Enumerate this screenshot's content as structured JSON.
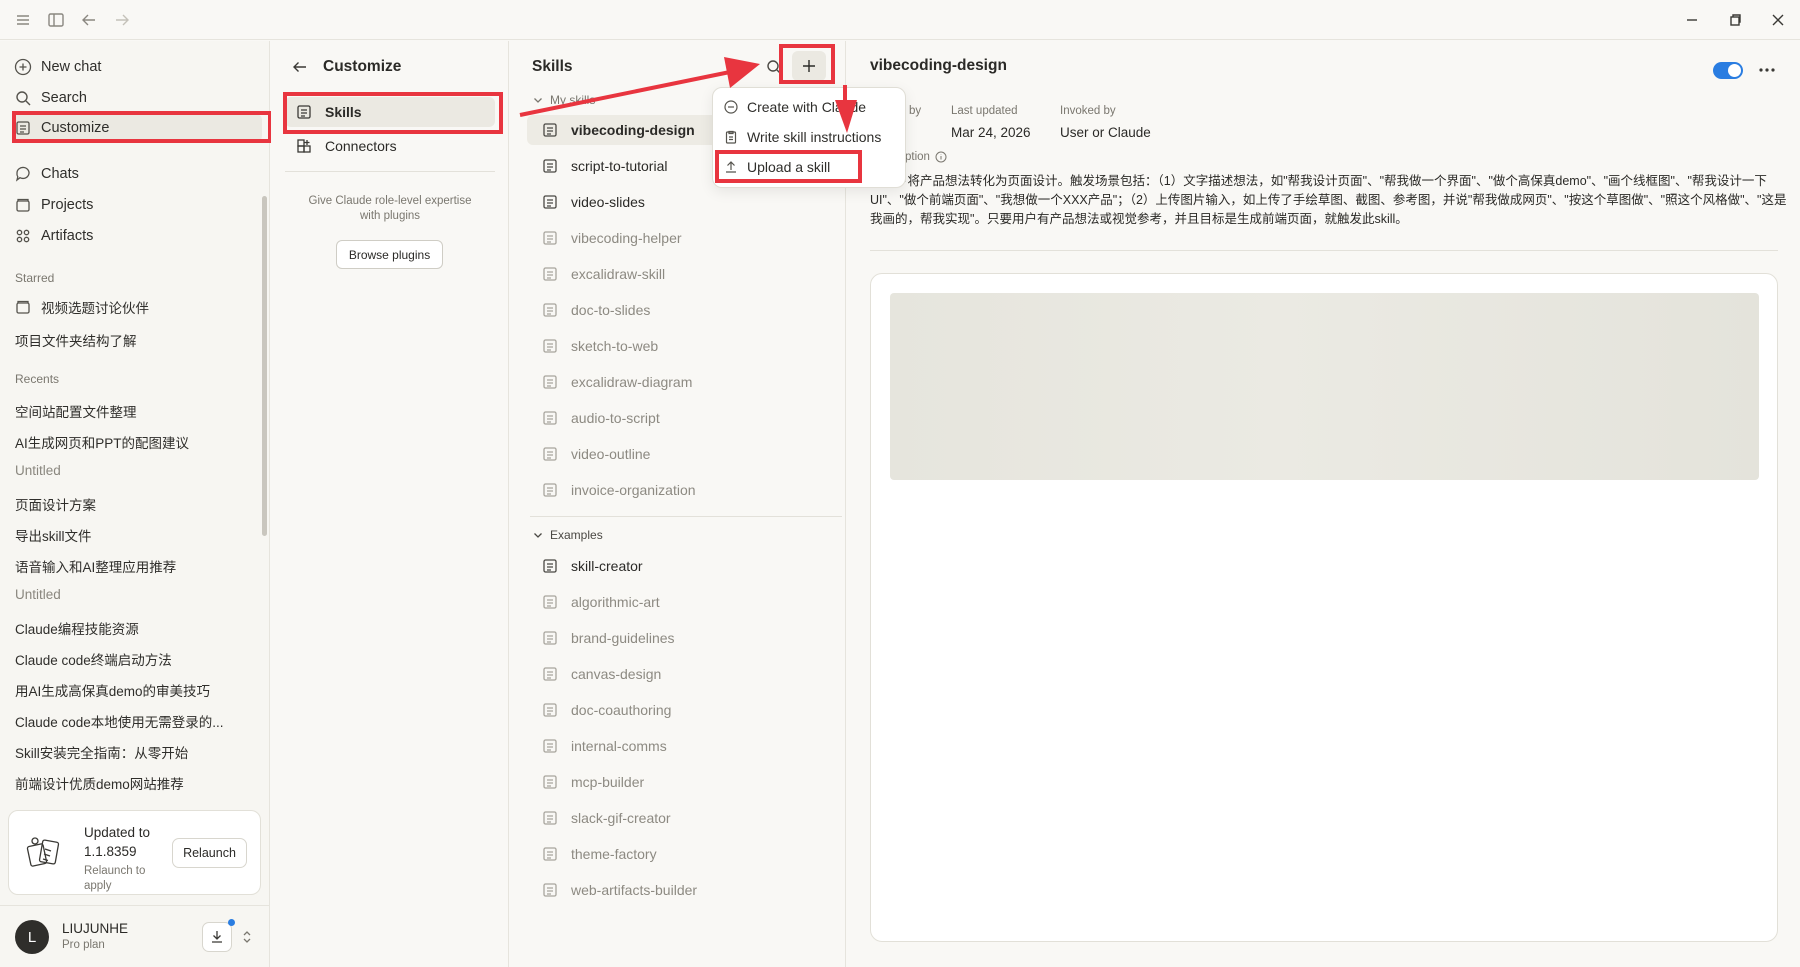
{
  "sidebar": {
    "new_chat": "New chat",
    "search": "Search",
    "customize": "Customize",
    "chats": "Chats",
    "projects": "Projects",
    "artifacts": "Artifacts",
    "starred_label": "Starred",
    "starred": [
      "视频选题讨论伙伴",
      "项目文件夹结构了解"
    ],
    "recents_label": "Recents",
    "recents": [
      "空间站配置文件整理",
      "AI生成网页和PPT的配图建议",
      "Untitled",
      "页面设计方案",
      "导出skill文件",
      "语音输入和AI整理应用推荐",
      "Untitled",
      "Claude编程技能资源",
      "Claude code终端启动方法",
      "用AI生成高保真demo的审美技巧",
      "Claude code本地使用无需登录的...",
      "Skill安装完全指南：从零开始",
      "前端设计优质demo网站推荐"
    ],
    "update": {
      "title": "Updated to 1.1.8359",
      "subtitle": "Relaunch to apply",
      "button": "Relaunch"
    },
    "user": {
      "initial": "L",
      "name": "LIUJUNHE",
      "plan": "Pro plan"
    }
  },
  "customize": {
    "title": "Customize",
    "skills": "Skills",
    "connectors": "Connectors",
    "plugins_text": "Give Claude role-level expertise with plugins",
    "browse_button": "Browse plugins"
  },
  "skills": {
    "title": "Skills",
    "my_skills_label": "My skills",
    "my_skills": [
      "vibecoding-design",
      "script-to-tutorial",
      "video-slides",
      "vibecoding-helper",
      "excalidraw-skill",
      "doc-to-slides",
      "sketch-to-web",
      "excalidraw-diagram",
      "audio-to-script",
      "video-outline",
      "invoice-organization"
    ],
    "examples_label": "Examples",
    "examples": [
      "skill-creator",
      "algorithmic-art",
      "brand-guidelines",
      "canvas-design",
      "doc-coauthoring",
      "internal-comms",
      "mcp-builder",
      "slack-gif-creator",
      "theme-factory",
      "web-artifacts-builder"
    ]
  },
  "menu": {
    "create": "Create with Claude",
    "write": "Write skill instructions",
    "upload": "Upload a skill"
  },
  "detail": {
    "title": "vibecoding-design",
    "added_by_label": "by",
    "last_updated_label": "Last updated",
    "last_updated_value": "Mar 24, 2026",
    "invoked_by_label": "Invoked by",
    "invoked_by_value": "User or Claude",
    "description_label": "ption",
    "description": "手用户将产品想法转化为页面设计。触发场景包括：（1）文字描述想法，如\"帮我设计页面\"、\"帮我做一个界面\"、\"做个高保真demo\"、\"画个线框图\"、\"帮我设计一下UI\"、\"做个前端页面\"、\"我想做一个XXX产品\"；（2）上传图片输入，如上传了手绘草图、截图、参考图，并说\"帮我做成网页\"、\"按这个草图做\"、\"照这个风格做\"、\"这是我画的，帮我实现\"。只要用户有产品想法或视觉参考，并且目标是生成前端页面，就触发此skill。"
  },
  "colors": {
    "accent": "#2a7de1",
    "annotation": "#e8353f"
  }
}
